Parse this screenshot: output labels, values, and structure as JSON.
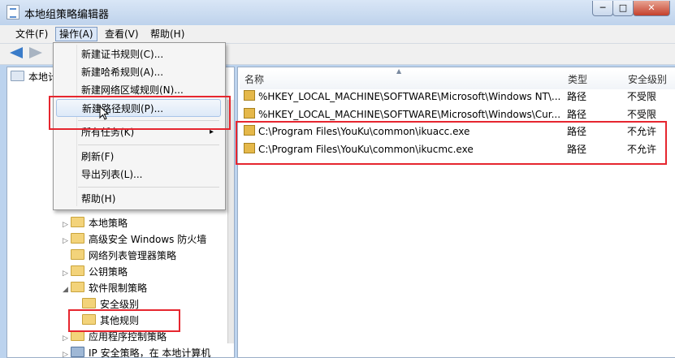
{
  "window": {
    "title": "本地组策略编辑器",
    "min": "─",
    "max": "□",
    "close": "✕"
  },
  "menu": {
    "file": "文件(F)",
    "action": "操作(A)",
    "view": "查看(V)",
    "help": "帮助(H)"
  },
  "dropdown": {
    "items": [
      "新建证书规则(C)...",
      "新建哈希规则(A)...",
      "新建网络区域规则(N)...",
      "新建路径规则(P)...",
      "所有任务(K)",
      "刷新(F)",
      "导出列表(L)...",
      "帮助(H)"
    ],
    "submenu_arrow": "▸"
  },
  "tree": {
    "root": "本地计算机 策略",
    "items": [
      "本地策略",
      "高级安全 Windows 防火墙",
      "网络列表管理器策略",
      "公钥策略",
      "软件限制策略",
      "安全级别",
      "其他规则",
      "应用程序控制策略",
      "IP 安全策略，在 本地计算机"
    ]
  },
  "list": {
    "headers": {
      "name": "名称",
      "type": "类型",
      "level": "安全级别"
    },
    "rows": [
      {
        "name": "%HKEY_LOCAL_MACHINE\\SOFTWARE\\Microsoft\\Windows NT\\...",
        "type": "路径",
        "level": "不受限"
      },
      {
        "name": "%HKEY_LOCAL_MACHINE\\SOFTWARE\\Microsoft\\Windows\\Cur...",
        "type": "路径",
        "level": "不受限"
      },
      {
        "name": "C:\\Program Files\\YouKu\\common\\ikuacc.exe",
        "type": "路径",
        "level": "不允许"
      },
      {
        "name": "C:\\Program Files\\YouKu\\common\\ikucmc.exe",
        "type": "路径",
        "level": "不允许"
      }
    ]
  },
  "colors": {
    "highlight": "#e6262f",
    "accent": "#3a7cc9"
  }
}
